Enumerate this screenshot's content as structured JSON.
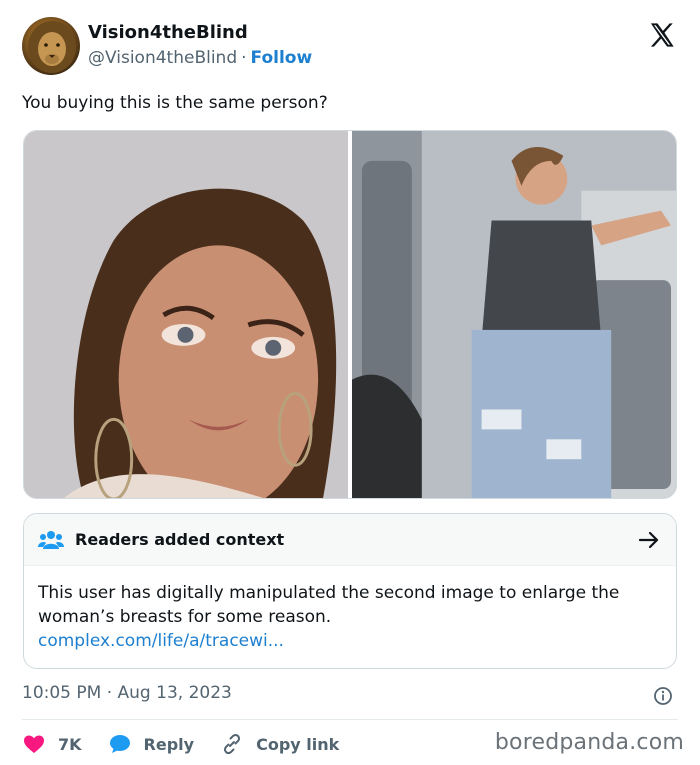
{
  "author": {
    "name": "Vision4theBlind",
    "handle": "@Vision4theBlind",
    "separator": "·",
    "follow_label": "Follow",
    "avatar_icon": "lion-avatar"
  },
  "tweet": {
    "text": "You buying this is the same person?"
  },
  "media": [
    {
      "alt_icon": "woman-selfie-photo"
    },
    {
      "alt_icon": "woman-airplane-aisle-photo"
    }
  ],
  "context": {
    "title": "Readers added context",
    "body": "This user has digitally manipulated the second image to enlarge the woman’s breasts for some reason.",
    "link": "complex.com/life/a/tracewi..."
  },
  "meta": {
    "timestamp": "10:05 PM · Aug 13, 2023"
  },
  "actions": {
    "like_count": "7K",
    "reply_label": "Reply",
    "copy_label": "Copy link"
  },
  "watermark": "boredpanda.com",
  "colors": {
    "link": "#1d7fd0",
    "like": "#f91880",
    "reply": "#1d9bf0",
    "muted": "#536471"
  }
}
